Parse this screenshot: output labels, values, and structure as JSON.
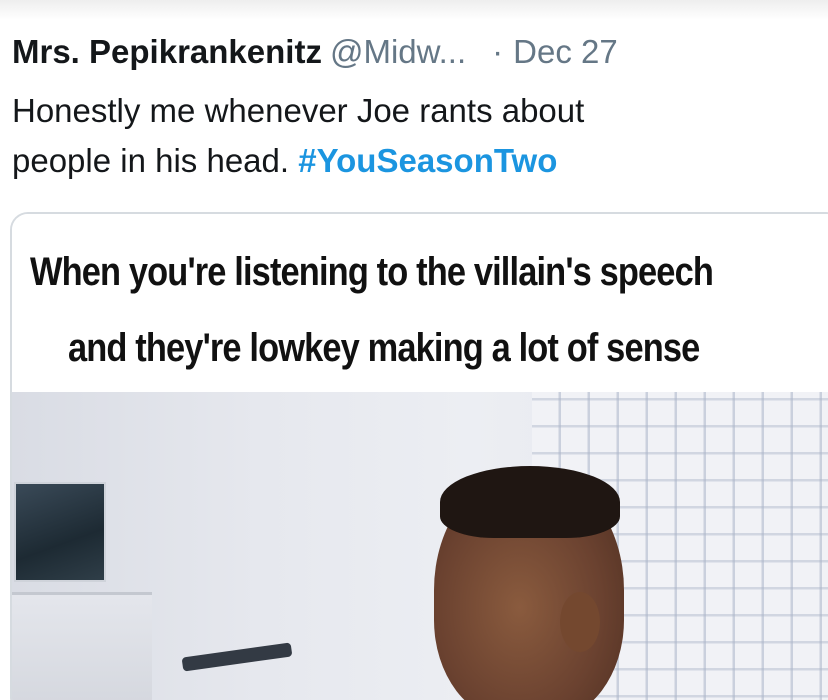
{
  "tweet": {
    "display_name": "Mrs. Pepikrankenitz",
    "handle": "@Midw...",
    "separator": "·",
    "date": "Dec 27",
    "text_line1": "Honestly me whenever Joe rants about",
    "text_line2_prefix": "people in his head. ",
    "hashtag": "#YouSeasonTwo",
    "hashtag_color": "#1b95e0"
  },
  "media": {
    "caption_line1": "When you're listening to the villain's speech",
    "caption_line2": "and they're lowkey making a lot of sense"
  }
}
